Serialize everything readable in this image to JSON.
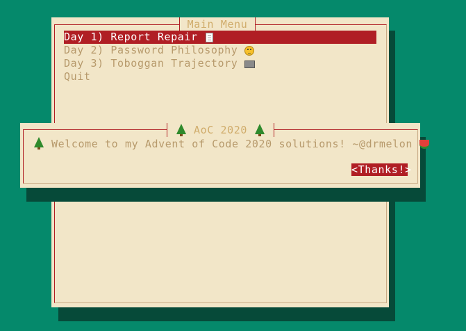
{
  "main_menu": {
    "title": "Main Menu",
    "items": [
      {
        "label": "Day 1) Report Repair",
        "icon": "page-icon",
        "selected": true
      },
      {
        "label": "Day 2) Password Philosophy",
        "icon": "face-icon",
        "selected": false
      },
      {
        "label": "Day 3) Toboggan Trajectory",
        "icon": "sled-icon",
        "selected": false
      },
      {
        "label": "Quit",
        "icon": "",
        "selected": false
      }
    ]
  },
  "dialog": {
    "title": "AoC 2020",
    "title_icon": "christmas-tree-icon",
    "message": "Welcome to my Advent of Code 2020 solutions! ~@drmelon",
    "message_icons": [
      "christmas-tree-icon",
      "watermelon-icon"
    ],
    "button_label": "<Thanks!>"
  },
  "colors": {
    "background": "#05896b",
    "panel": "#f2e6c8",
    "accent": "#b01e24",
    "muted_text": "#b79a6c",
    "title_text": "#d0ac6b",
    "shadow": "#064a39"
  }
}
